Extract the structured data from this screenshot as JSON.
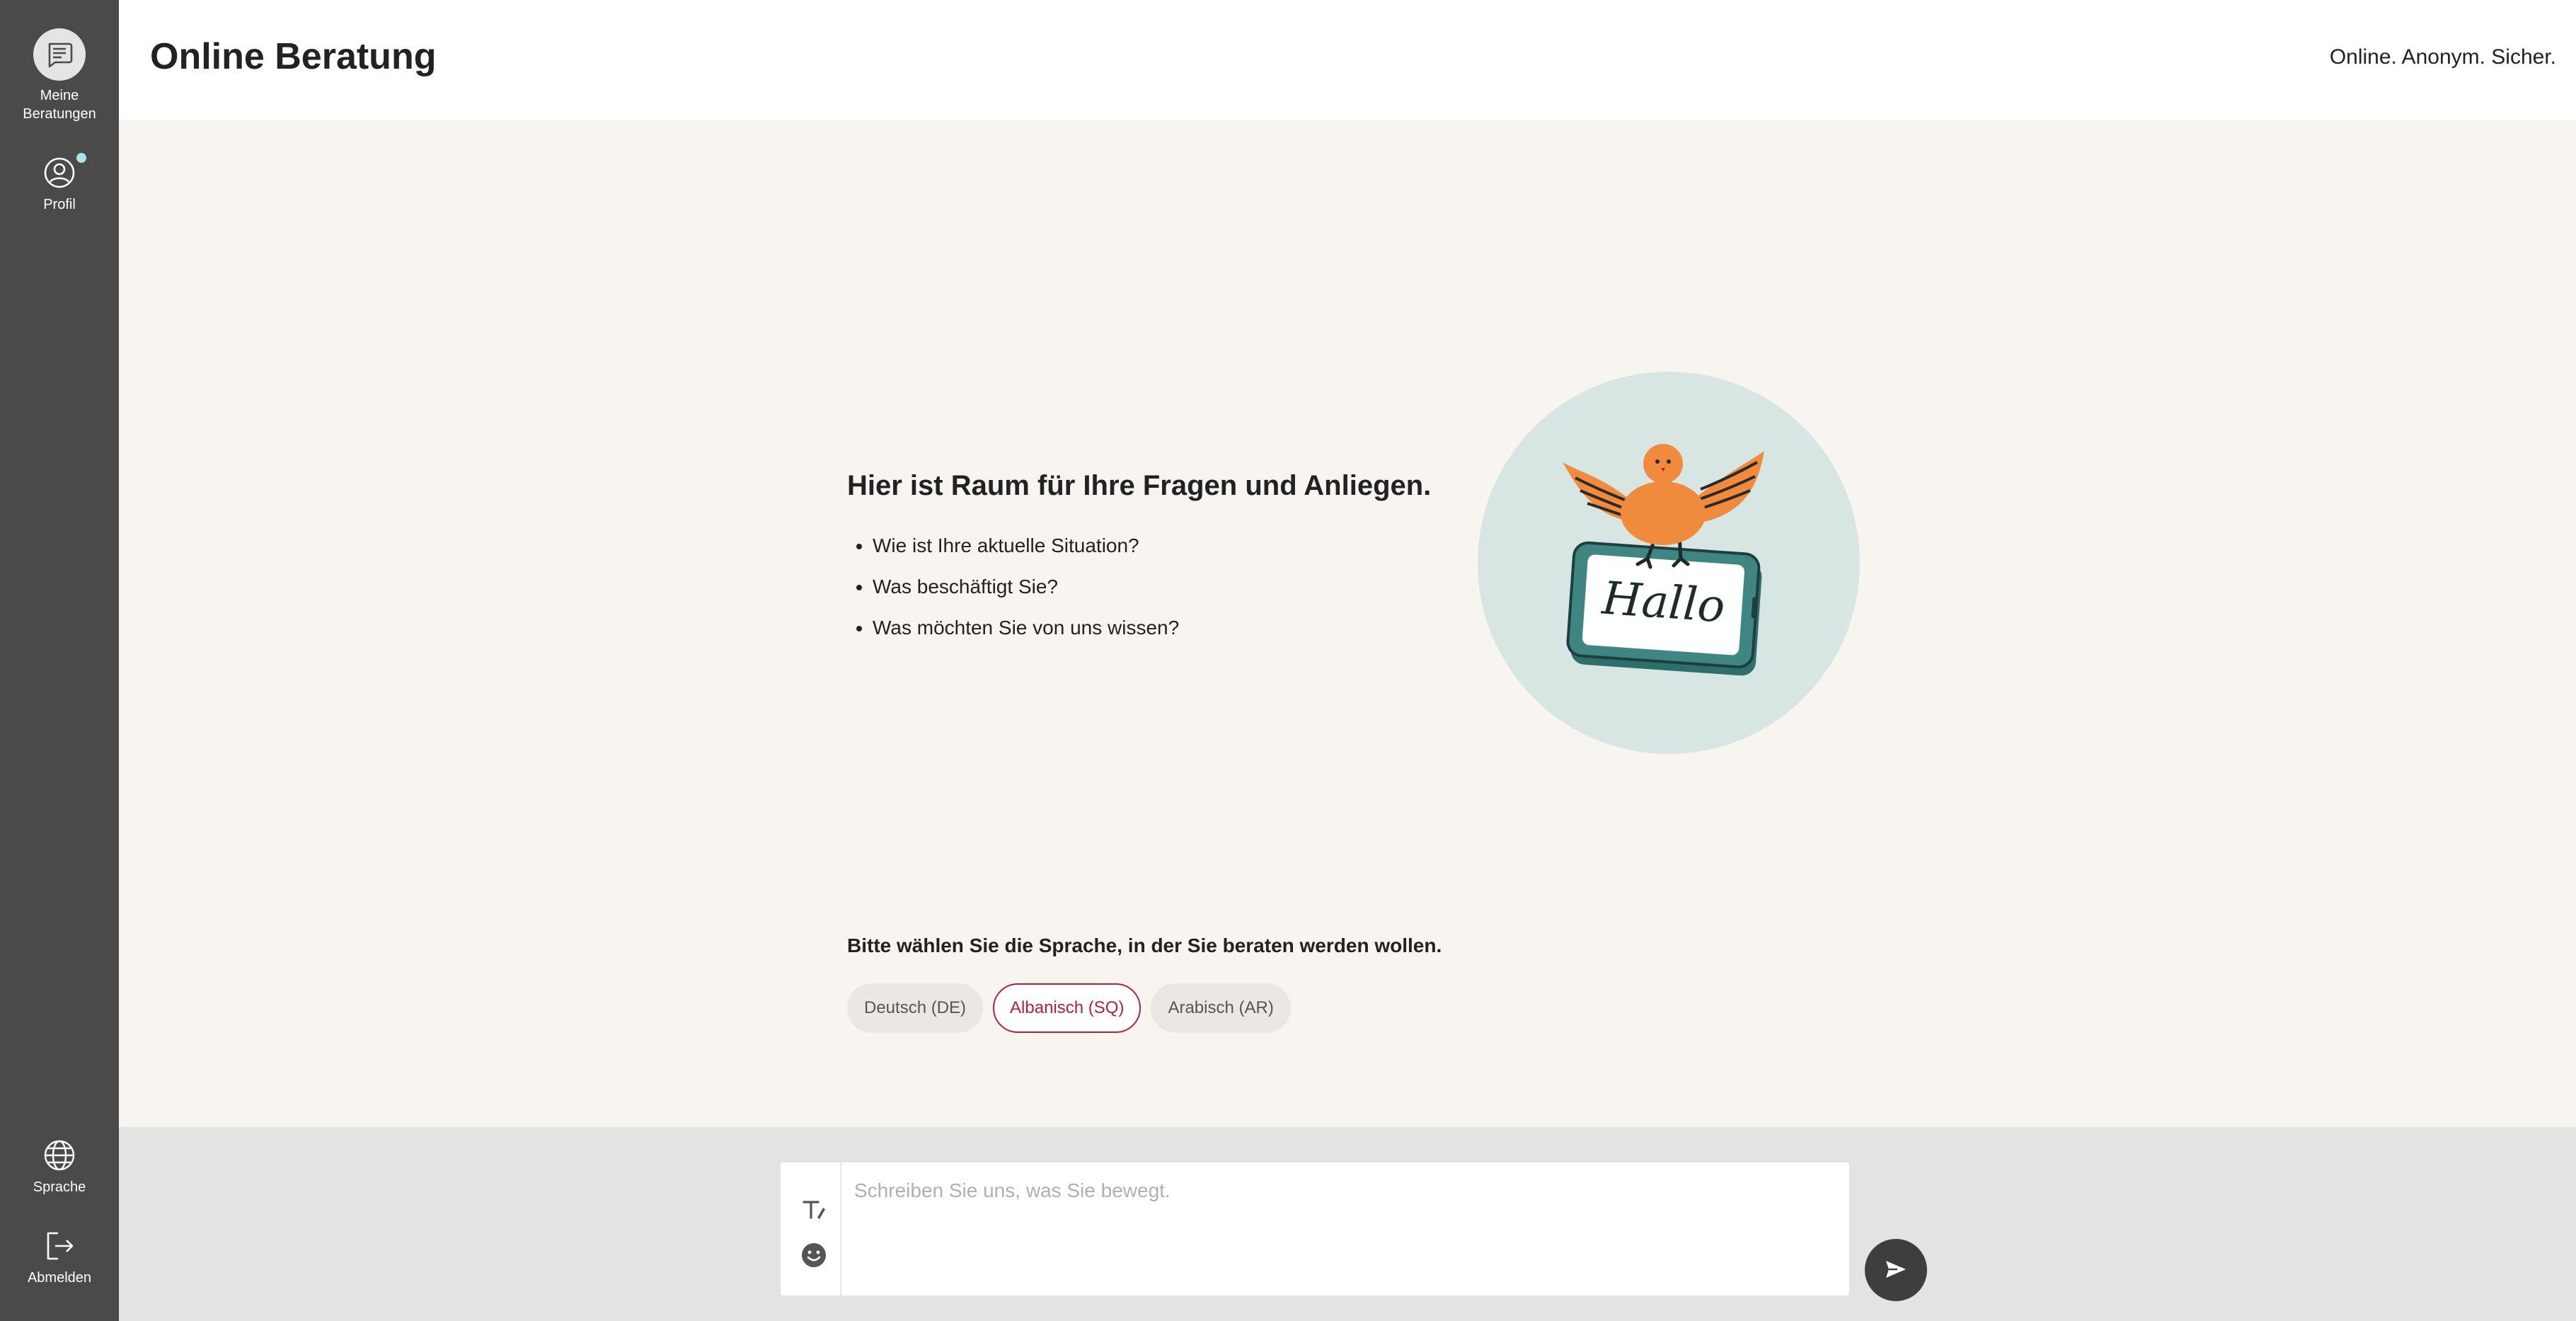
{
  "sidebar": {
    "items": [
      {
        "label_line1": "Meine",
        "label_line2": "Beratungen",
        "icon": "chat-list-icon"
      },
      {
        "label": "Profil",
        "icon": "user-circle-icon",
        "has_notification": true
      },
      {
        "label": "Sprache",
        "icon": "globe-icon"
      },
      {
        "label": "Abmelden",
        "icon": "logout-icon"
      }
    ]
  },
  "header": {
    "title": "Online Beratung",
    "claim": "Online. Anonym. Sicher."
  },
  "intro": {
    "heading": "Hier ist Raum für Ihre Fragen und Anliegen.",
    "questions": [
      "Wie ist Ihre aktuelle Situation?",
      "Was beschäftigt Sie?",
      "Was möchten Sie von uns wissen?"
    ],
    "illustration_text": "Hallo"
  },
  "language": {
    "prompt": "Bitte wählen Sie die Sprache, in der Sie beraten werden wollen.",
    "options": [
      {
        "label": "Deutsch (DE)",
        "selected": false
      },
      {
        "label": "Albanisch (SQ)",
        "selected": true
      },
      {
        "label": "Arabisch (AR)",
        "selected": false
      }
    ]
  },
  "composer": {
    "placeholder": "Schreiben Sie uns, was Sie bewegt.",
    "value": ""
  },
  "colors": {
    "sidebar_bg": "#4a4a4a",
    "main_bg": "#f8f5f1",
    "accent": "#b5213a",
    "illustration_circle": "#d8e6e3",
    "bird_orange": "#f08a3c",
    "phone_teal": "#2e6e6b"
  }
}
